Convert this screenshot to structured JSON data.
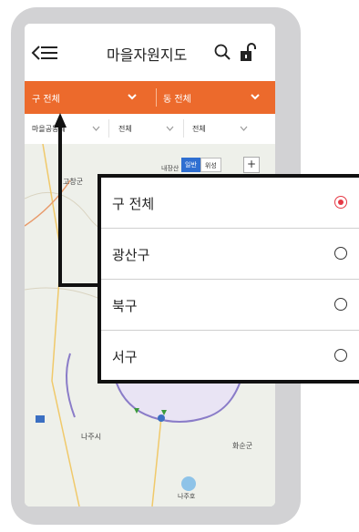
{
  "header": {
    "title": "마을자원지도"
  },
  "orange_bar": {
    "district_label": "구 전체",
    "dong_label": "동 전체"
  },
  "filters": {
    "category": "마을공동체",
    "filter2": "전체",
    "filter3": "전체"
  },
  "map": {
    "toggle_general": "일반",
    "toggle_satellite": "위성",
    "zoom_in": "+",
    "labels": [
      "고창군",
      "나주시",
      "화순군",
      "내장산",
      "나주호"
    ]
  },
  "popup": {
    "options": [
      {
        "label": "구 전체",
        "selected": true
      },
      {
        "label": "광산구",
        "selected": false
      },
      {
        "label": "북구",
        "selected": false
      },
      {
        "label": "서구",
        "selected": false
      }
    ]
  },
  "colors": {
    "accent_orange": "#ec6a2c",
    "radio_selected": "#e53945",
    "map_blue": "#2f6fd1"
  }
}
